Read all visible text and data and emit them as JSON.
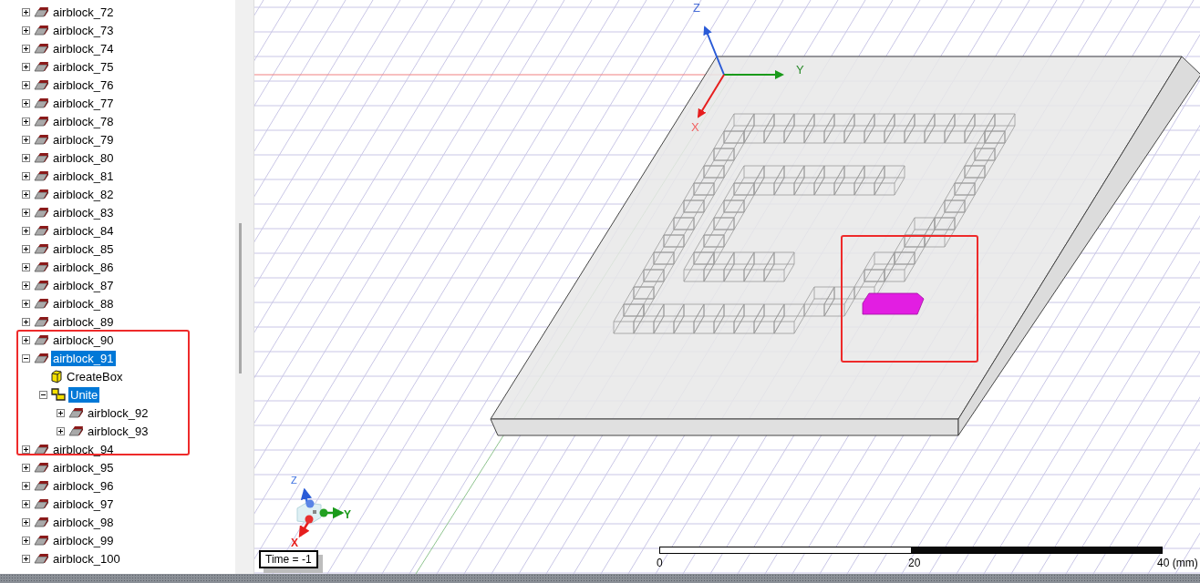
{
  "tree": {
    "items": [
      {
        "label": "airblock_72",
        "kind": "solid",
        "expanded": false,
        "selected": false
      },
      {
        "label": "airblock_73",
        "kind": "solid",
        "expanded": false,
        "selected": false
      },
      {
        "label": "airblock_74",
        "kind": "solid",
        "expanded": false,
        "selected": false
      },
      {
        "label": "airblock_75",
        "kind": "solid",
        "expanded": false,
        "selected": false
      },
      {
        "label": "airblock_76",
        "kind": "solid",
        "expanded": false,
        "selected": false
      },
      {
        "label": "airblock_77",
        "kind": "solid",
        "expanded": false,
        "selected": false
      },
      {
        "label": "airblock_78",
        "kind": "solid",
        "expanded": false,
        "selected": false
      },
      {
        "label": "airblock_79",
        "kind": "solid",
        "expanded": false,
        "selected": false
      },
      {
        "label": "airblock_80",
        "kind": "solid",
        "expanded": false,
        "selected": false
      },
      {
        "label": "airblock_81",
        "kind": "solid",
        "expanded": false,
        "selected": false
      },
      {
        "label": "airblock_82",
        "kind": "solid",
        "expanded": false,
        "selected": false
      },
      {
        "label": "airblock_83",
        "kind": "solid",
        "expanded": false,
        "selected": false
      },
      {
        "label": "airblock_84",
        "kind": "solid",
        "expanded": false,
        "selected": false
      },
      {
        "label": "airblock_85",
        "kind": "solid",
        "expanded": false,
        "selected": false
      },
      {
        "label": "airblock_86",
        "kind": "solid",
        "expanded": false,
        "selected": false
      },
      {
        "label": "airblock_87",
        "kind": "solid",
        "expanded": false,
        "selected": false
      },
      {
        "label": "airblock_88",
        "kind": "solid",
        "expanded": false,
        "selected": false
      },
      {
        "label": "airblock_89",
        "kind": "solid",
        "expanded": false,
        "selected": false
      },
      {
        "label": "airblock_90",
        "kind": "solid",
        "expanded": false,
        "selected": false
      },
      {
        "label": "airblock_91",
        "kind": "solid",
        "expanded": true,
        "selected": true,
        "children": [
          {
            "label": "CreateBox",
            "kind": "create",
            "selected": false
          },
          {
            "label": "Unite",
            "kind": "unite",
            "expanded": true,
            "selected": true,
            "children": [
              {
                "label": "airblock_92",
                "kind": "solid",
                "expanded": false,
                "selected": false
              },
              {
                "label": "airblock_93",
                "kind": "solid",
                "expanded": false,
                "selected": false
              }
            ]
          }
        ]
      },
      {
        "label": "airblock_94",
        "kind": "solid",
        "expanded": false,
        "selected": false
      },
      {
        "label": "airblock_95",
        "kind": "solid",
        "expanded": false,
        "selected": false
      },
      {
        "label": "airblock_96",
        "kind": "solid",
        "expanded": false,
        "selected": false
      },
      {
        "label": "airblock_97",
        "kind": "solid",
        "expanded": false,
        "selected": false
      },
      {
        "label": "airblock_98",
        "kind": "solid",
        "expanded": false,
        "selected": false
      },
      {
        "label": "airblock_99",
        "kind": "solid",
        "expanded": false,
        "selected": false
      },
      {
        "label": "airblock_100",
        "kind": "solid",
        "expanded": false,
        "selected": false
      }
    ]
  },
  "viewport": {
    "axes": {
      "z": "Z",
      "y": "Y",
      "x": "X"
    },
    "triad": {
      "z": "Z",
      "y": "Y",
      "x": "X"
    },
    "time_label": "Time = -1",
    "scale_ticks": [
      "0",
      "20",
      "40 (mm)"
    ]
  }
}
